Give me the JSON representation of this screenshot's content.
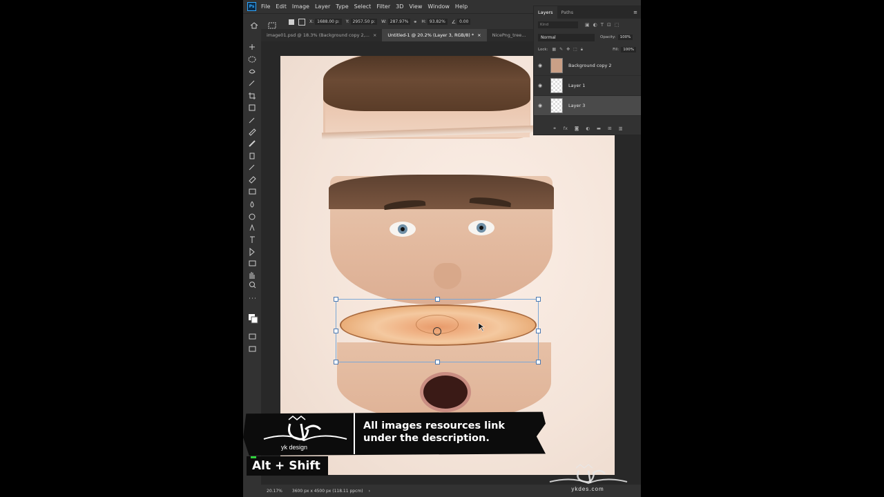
{
  "app": {
    "logo": "Ps"
  },
  "menu": [
    "File",
    "Edit",
    "Image",
    "Layer",
    "Type",
    "Select",
    "Filter",
    "3D",
    "View",
    "Window",
    "Help"
  ],
  "options": {
    "x_label": "X:",
    "x": "1688.00 p:",
    "y_label": "Y:",
    "y": "2957.50 p:",
    "w_label": "W:",
    "w": "287.97%",
    "h_label": "H:",
    "h": "93.82%",
    "angle": "0.00"
  },
  "tabs": [
    {
      "label": "image01.psd @ 18.3% (Background copy 2,..."
    },
    {
      "label": "Untitled-1 @ 20.2% (Layer 3, RGB/8) *"
    },
    {
      "label": "NicePng_tree..."
    }
  ],
  "tab_close": "×",
  "layers": {
    "tabs": [
      "Layers",
      "Paths"
    ],
    "search_placeholder": "Kind",
    "blend_mode": "Normal",
    "opacity_label": "Opacity:",
    "opacity": "100%",
    "lock_label": "Lock:",
    "fill_label": "Fill:",
    "fill": "100%",
    "items": [
      {
        "name": "Background copy 2"
      },
      {
        "name": "Layer 1"
      },
      {
        "name": "Layer 3"
      }
    ],
    "selected_index": 2
  },
  "status": {
    "zoom": "20.17%",
    "doc": "3600 px x 4500 px (118.11 ppcm)"
  },
  "overlay": {
    "brand": "yk design",
    "banner_line1": "All images resources link",
    "banner_line2": "under the description.",
    "shortcut": "Alt + Shift",
    "watermark": "ykdes.com"
  },
  "colors": {
    "accent": "#31a8ff",
    "chrome": "#323232",
    "shortcut_accent": "#2ed23b"
  }
}
